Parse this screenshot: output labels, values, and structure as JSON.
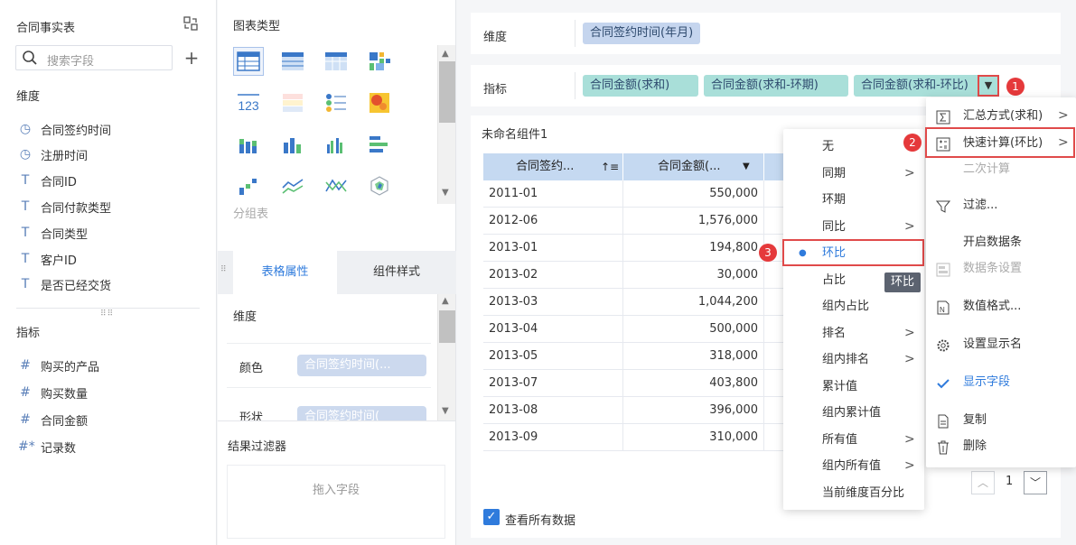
{
  "left": {
    "title": "合同事实表",
    "search_placeholder": "搜索字段",
    "dimension_label": "维度",
    "dimensions": [
      "合同签约时间",
      "注册时间",
      "合同ID",
      "合同付款类型",
      "合同类型",
      "客户ID",
      "是否已经交货"
    ],
    "metric_label": "指标",
    "metrics": [
      "购买的产品",
      "购买数量",
      "合同金额",
      "记录数"
    ]
  },
  "mid": {
    "chart_type_label": "图表类型",
    "group_label": "分组表",
    "tabs": [
      "表格属性",
      "组件样式"
    ],
    "dim_label": "维度",
    "color_label": "颜色",
    "color_value": "合同签约时间(...",
    "shape_label": "形状",
    "shape_value": "合同签约时间(",
    "filter_label": "结果过滤器",
    "drop_hint": "拖入字段"
  },
  "config": {
    "dim_row_label": "维度",
    "dim_chip": "合同签约时间(年月)",
    "metric_row_label": "指标",
    "metric_chips": [
      "合同金额(求和)",
      "合同金额(求和-环期)",
      "合同金额(求和-环比)"
    ]
  },
  "table": {
    "component_name": "未命名组件1",
    "headers": [
      "合同签约...",
      "合同金额(..."
    ],
    "rows": [
      [
        "2011-01",
        "550,000"
      ],
      [
        "2012-06",
        "1,576,000"
      ],
      [
        "2013-01",
        "194,800"
      ],
      [
        "2013-02",
        "30,000"
      ],
      [
        "2013-03",
        "1,044,200"
      ],
      [
        "2013-04",
        "500,000"
      ],
      [
        "2013-05",
        "318,000"
      ],
      [
        "2013-07",
        "403,800"
      ],
      [
        "2013-08",
        "396,000"
      ],
      [
        "2013-09",
        "310,000"
      ]
    ],
    "view_all": "查看所有数据",
    "page": "1"
  },
  "menu_right": {
    "items": [
      {
        "label": "汇总方式(求和)",
        "icon": "sigma-icon",
        "arrow": true
      },
      {
        "label": "快速计算(环比)",
        "icon": "calc-icon",
        "arrow": true
      },
      {
        "label": "二次计算",
        "icon": "",
        "arrow": false,
        "disabled": true
      },
      {
        "label": "过滤...",
        "icon": "filter-icon",
        "arrow": false
      },
      {
        "label": "开启数据条",
        "icon": "",
        "arrow": false
      },
      {
        "label": "数据条设置",
        "icon": "databar-icon",
        "arrow": false,
        "disabled": true
      },
      {
        "label": "数值格式...",
        "icon": "number-format-icon",
        "arrow": false
      },
      {
        "label": "设置显示名",
        "icon": "gear-icon",
        "arrow": false
      },
      {
        "label": "显示字段",
        "icon": "check-icon",
        "arrow": false,
        "active": true
      },
      {
        "label": "复制",
        "icon": "copy-icon",
        "arrow": false
      },
      {
        "label": "删除",
        "icon": "trash-icon",
        "arrow": false
      }
    ]
  },
  "menu_sub": {
    "items": [
      {
        "label": "无",
        "arrow": false
      },
      {
        "label": "同期",
        "arrow": true
      },
      {
        "label": "环期",
        "arrow": false
      },
      {
        "label": "同比",
        "arrow": true
      },
      {
        "label": "环比",
        "arrow": false,
        "selected": true
      },
      {
        "label": "占比",
        "arrow": false
      },
      {
        "label": "组内占比",
        "arrow": false
      },
      {
        "label": "排名",
        "arrow": true
      },
      {
        "label": "组内排名",
        "arrow": true
      },
      {
        "label": "累计值",
        "arrow": false
      },
      {
        "label": "组内累计值",
        "arrow": false
      },
      {
        "label": "所有值",
        "arrow": true
      },
      {
        "label": "组内所有值",
        "arrow": true
      },
      {
        "label": "当前维度百分比",
        "arrow": false
      }
    ],
    "tooltip": "环比"
  },
  "badges": [
    "1",
    "2",
    "3"
  ],
  "colors": {
    "accent": "#2f7bdc",
    "header": "#c5d9f1",
    "badge": "#e5393b",
    "metric_chip": "#a9dfd9",
    "dim_chip": "#c5d5ee"
  }
}
